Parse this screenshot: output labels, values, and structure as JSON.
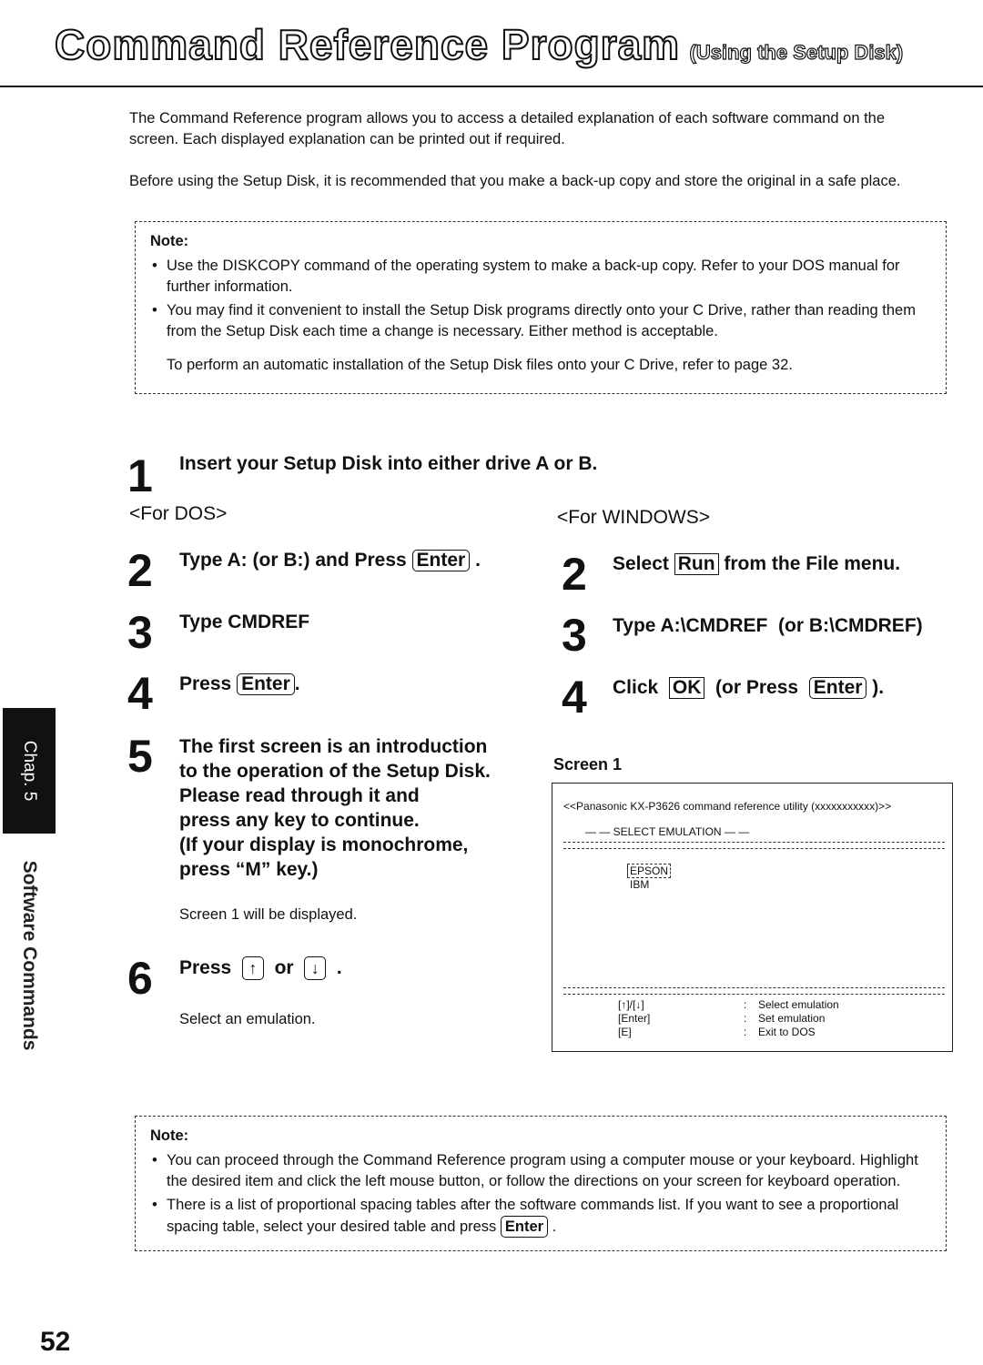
{
  "header": {
    "title": "Command Reference Program",
    "subtitle": "(Using the Setup Disk)"
  },
  "intro": {
    "p1": "The Command Reference program allows you to access a detailed explanation of each software command on the screen. Each displayed explanation can be printed out if required.",
    "p2": "Before using the Setup Disk, it is recommended that you make a back-up copy and store the original in a safe place."
  },
  "note1": {
    "label": "Note:",
    "bullets": [
      "Use the DISKCOPY command of the operating system to make a back-up copy. Refer to your DOS manual for further information.",
      "You may find it convenient to install the Setup Disk programs directly onto your C Drive, rather than reading them from the Setup Disk each time a change is necessary. Either method is acceptable."
    ],
    "extra": "To perform an automatic installation of the Setup Disk files onto your C Drive, refer to page 32."
  },
  "step1": {
    "num": "1",
    "text": "Insert your Setup Disk into either drive A or B."
  },
  "dos": {
    "heading": "<For DOS>",
    "step2": {
      "num": "2",
      "text_a": "Type A:  (or B:) and Press",
      "key": "Enter",
      "text_b": "."
    },
    "step3": {
      "num": "3",
      "text": "Type CMDREF"
    },
    "step4": {
      "num": "4",
      "text_a": "Press",
      "key": "Enter",
      "text_b": "."
    },
    "step5": {
      "num": "5",
      "lines": [
        "The first screen is an introduction",
        "to the operation of the Setup Disk.",
        "Please read through it and",
        "press any key to continue.",
        "(If your display is monochrome,",
        "press “M” key.)"
      ],
      "sub": "Screen 1 will be displayed."
    },
    "step6": {
      "num": "6",
      "text_a": "Press",
      "key_up": "↑",
      "text_or": "or",
      "key_down": "↓",
      "text_b": ".",
      "sub": "Select an emulation."
    }
  },
  "windows": {
    "heading": "<For WINDOWS>",
    "step2": {
      "num": "2",
      "text_a": "Select",
      "button": "Run",
      "text_b": "from the File menu."
    },
    "step3": {
      "num": "3",
      "text": "Type A:\\CMDREF  (or B:\\CMDREF)"
    },
    "step4": {
      "num": "4",
      "text_a": "Click",
      "button": "OK",
      "text_b": "(or Press",
      "key": "Enter",
      "text_c": ")."
    }
  },
  "screen1": {
    "label": "Screen 1",
    "banner": "<<Panasonic KX-P3626 command reference utility (xxxxxxxxxxx)>>",
    "section": "— — SELECT EMULATION — —",
    "options": [
      "EPSON",
      "IBM"
    ],
    "selected": "EPSON",
    "keys": [
      {
        "key": "[↑]/[↓]",
        "sep": ":",
        "action": "Select emulation"
      },
      {
        "key": "[Enter]",
        "sep": ":",
        "action": "Set emulation"
      },
      {
        "key": "[E]",
        "sep": ":",
        "action": "Exit to DOS"
      }
    ]
  },
  "note2": {
    "label": "Note:",
    "bullets": [
      "You can proceed through the Command Reference program using a computer mouse or your keyboard. Highlight the desired item and click the left mouse button, or follow the directions on your screen for keyboard operation."
    ],
    "bullet2_a": "There is a list of proportional spacing tables after the software commands list. If you want to see a proportional spacing table, select your desired table and press",
    "bullet2_key": "Enter",
    "bullet2_b": "."
  },
  "side": {
    "chapter": "Chap. 5",
    "section": "Software Commands"
  },
  "page_number": "52"
}
